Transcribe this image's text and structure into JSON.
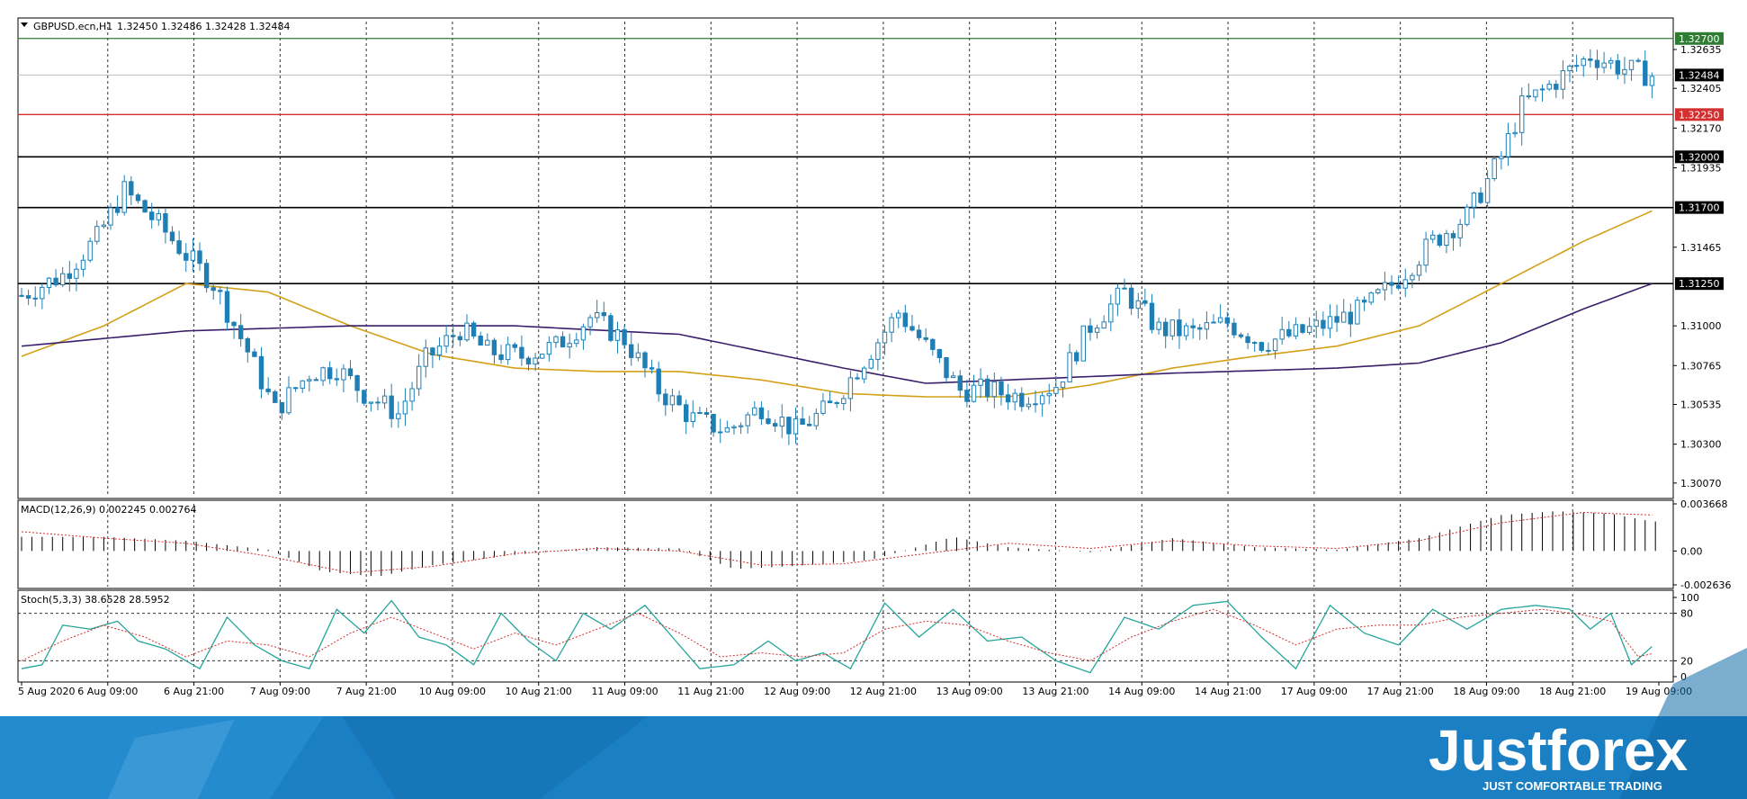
{
  "header": {
    "symbol": "GBPUSD.ecn,H1",
    "ohlc": "1.32450 1.32486 1.32428 1.32484"
  },
  "indicators": {
    "macd_label": "MACD(12,26,9) 0.002245 0.002764",
    "stoch_label": "Stoch(5,3,3) 38.6528 28.5952"
  },
  "brand": {
    "name": "Justforex",
    "tagline": "JUST COMFORTABLE TRADING"
  },
  "colors": {
    "candle_bull": "#1f7fb5",
    "candle_bear": "#1f7fb5",
    "ma_fast": "#d4a017",
    "ma_slow": "#3a1f6b",
    "level_green": "#2e7d32",
    "level_red": "#d32f2f",
    "level_black": "#000000",
    "macd_signal": "#d32f2f",
    "stoch_main": "#26a69a",
    "stoch_signal": "#d32f2f",
    "brand_bg": "#1b7fc4"
  },
  "chart_data": [
    {
      "type": "candlestick",
      "title": "GBPUSD.ecn,H1",
      "ylim": [
        1.3,
        1.328
      ],
      "y_ticks": [
        "1.32635",
        "1.32405",
        "1.32170",
        "1.31935",
        "1.31465",
        "1.31000",
        "1.30765",
        "1.30535",
        "1.30300",
        "1.30070"
      ],
      "x_ticks": [
        "5 Aug 2020",
        "6 Aug 09:00",
        "6 Aug 21:00",
        "7 Aug 09:00",
        "7 Aug 21:00",
        "10 Aug 09:00",
        "10 Aug 21:00",
        "11 Aug 09:00",
        "11 Aug 21:00",
        "12 Aug 09:00",
        "12 Aug 21:00",
        "13 Aug 09:00",
        "13 Aug 21:00",
        "14 Aug 09:00",
        "14 Aug 21:00",
        "17 Aug 09:00",
        "17 Aug 21:00",
        "18 Aug 09:00",
        "18 Aug 21:00",
        "19 Aug 09:00"
      ],
      "levels": [
        {
          "value": 1.327,
          "label": "1.32700",
          "color": "green"
        },
        {
          "value": 1.32484,
          "label": "1.32484",
          "color": "current"
        },
        {
          "value": 1.3225,
          "label": "1.32250",
          "color": "red"
        },
        {
          "value": 1.32,
          "label": "1.32000",
          "color": "black"
        },
        {
          "value": 1.317,
          "label": "1.31700",
          "color": "black"
        },
        {
          "value": 1.3125,
          "label": "1.31250",
          "color": "black"
        }
      ],
      "close_path": [
        [
          0,
          1.3118
        ],
        [
          6,
          1.313
        ],
        [
          11,
          1.3152
        ],
        [
          15,
          1.318
        ],
        [
          20,
          1.316
        ],
        [
          24,
          1.3142
        ],
        [
          28,
          1.3125
        ],
        [
          33,
          1.3085
        ],
        [
          37,
          1.305
        ],
        [
          42,
          1.3072
        ],
        [
          46,
          1.3075
        ],
        [
          50,
          1.306
        ],
        [
          55,
          1.3048
        ],
        [
          59,
          1.308
        ],
        [
          64,
          1.3098
        ],
        [
          68,
          1.3085
        ],
        [
          73,
          1.3082
        ],
        [
          78,
          1.3088
        ],
        [
          83,
          1.3105
        ],
        [
          88,
          1.3092
        ],
        [
          93,
          1.3062
        ],
        [
          98,
          1.3045
        ],
        [
          103,
          1.3038
        ],
        [
          108,
          1.3052
        ],
        [
          113,
          1.3038
        ],
        [
          118,
          1.3052
        ],
        [
          123,
          1.308
        ],
        [
          128,
          1.3108
        ],
        [
          132,
          1.3088
        ],
        [
          137,
          1.3062
        ],
        [
          141,
          1.3062
        ],
        [
          146,
          1.3058
        ],
        [
          151,
          1.3065
        ],
        [
          156,
          1.31
        ],
        [
          161,
          1.312
        ],
        [
          166,
          1.3098
        ],
        [
          171,
          1.3096
        ],
        [
          176,
          1.3102
        ],
        [
          181,
          1.309
        ],
        [
          186,
          1.3095
        ],
        [
          191,
          1.3102
        ],
        [
          196,
          1.311
        ],
        [
          201,
          1.3128
        ],
        [
          206,
          1.315
        ],
        [
          211,
          1.3165
        ],
        [
          216,
          1.32
        ],
        [
          219,
          1.323
        ],
        [
          224,
          1.3245
        ],
        [
          229,
          1.326
        ],
        [
          234,
          1.3252
        ],
        [
          238,
          1.3248
        ]
      ],
      "ma_fast": [
        [
          0,
          1.3082
        ],
        [
          12,
          1.31
        ],
        [
          24,
          1.3125
        ],
        [
          36,
          1.312
        ],
        [
          48,
          1.31
        ],
        [
          60,
          1.3083
        ],
        [
          72,
          1.3075
        ],
        [
          84,
          1.3073
        ],
        [
          96,
          1.3073
        ],
        [
          108,
          1.3068
        ],
        [
          120,
          1.306
        ],
        [
          132,
          1.3058
        ],
        [
          144,
          1.3058
        ],
        [
          156,
          1.3065
        ],
        [
          168,
          1.3075
        ],
        [
          180,
          1.3082
        ],
        [
          192,
          1.3088
        ],
        [
          204,
          1.31
        ],
        [
          216,
          1.3125
        ],
        [
          228,
          1.315
        ],
        [
          238,
          1.3168
        ]
      ],
      "ma_slow": [
        [
          0,
          1.3088
        ],
        [
          24,
          1.3097
        ],
        [
          48,
          1.31
        ],
        [
          72,
          1.31
        ],
        [
          96,
          1.3095
        ],
        [
          120,
          1.3075
        ],
        [
          132,
          1.3066
        ],
        [
          144,
          1.3068
        ],
        [
          168,
          1.3072
        ],
        [
          192,
          1.3075
        ],
        [
          204,
          1.3078
        ],
        [
          216,
          1.309
        ],
        [
          228,
          1.311
        ],
        [
          238,
          1.3125
        ]
      ]
    },
    {
      "type": "bar",
      "title": "MACD(12,26,9) 0.002245 0.002764",
      "ylim": [
        -0.002636,
        0.003668
      ],
      "y_ticks": [
        "0.003668",
        "0.00",
        "-0.002636"
      ],
      "histogram": [
        [
          0,
          0.0011
        ],
        [
          12,
          0.0011
        ],
        [
          24,
          0.0008
        ],
        [
          36,
          0.0001
        ],
        [
          44,
          -0.0016
        ],
        [
          52,
          -0.002
        ],
        [
          60,
          -0.0011
        ],
        [
          72,
          -0.0003
        ],
        [
          84,
          0.0003
        ],
        [
          96,
          0.0002
        ],
        [
          104,
          -0.0014
        ],
        [
          112,
          -0.0012
        ],
        [
          124,
          -0.0007
        ],
        [
          136,
          0.0011
        ],
        [
          144,
          0.0003
        ],
        [
          156,
          -0.0001
        ],
        [
          168,
          0.001
        ],
        [
          180,
          0.0003
        ],
        [
          192,
          0.0001
        ],
        [
          204,
          0.001
        ],
        [
          216,
          0.0028
        ],
        [
          224,
          0.0031
        ],
        [
          232,
          0.0029
        ],
        [
          238,
          0.0023
        ]
      ],
      "signal": [
        [
          0,
          0.0015
        ],
        [
          12,
          0.001
        ],
        [
          24,
          0.0006
        ],
        [
          36,
          -0.0004
        ],
        [
          48,
          -0.0017
        ],
        [
          60,
          -0.0012
        ],
        [
          72,
          -0.0002
        ],
        [
          84,
          0.0002
        ],
        [
          96,
          0.0
        ],
        [
          108,
          -0.0011
        ],
        [
          120,
          -0.001
        ],
        [
          132,
          -0.0002
        ],
        [
          144,
          0.0006
        ],
        [
          156,
          0.0002
        ],
        [
          168,
          0.0008
        ],
        [
          180,
          0.0004
        ],
        [
          192,
          0.0002
        ],
        [
          204,
          0.0008
        ],
        [
          216,
          0.0022
        ],
        [
          228,
          0.003
        ],
        [
          238,
          0.0028
        ]
      ]
    },
    {
      "type": "line",
      "title": "Stoch(5,3,3) 38.6528 28.5952",
      "ylim": [
        0,
        100
      ],
      "y_ticks": [
        "100",
        "80",
        "20",
        "0"
      ],
      "levels": [
        80,
        20
      ],
      "main": [
        [
          0,
          10
        ],
        [
          3,
          15
        ],
        [
          6,
          65
        ],
        [
          10,
          60
        ],
        [
          14,
          70
        ],
        [
          17,
          45
        ],
        [
          21,
          35
        ],
        [
          26,
          10
        ],
        [
          30,
          75
        ],
        [
          34,
          40
        ],
        [
          38,
          20
        ],
        [
          42,
          10
        ],
        [
          46,
          85
        ],
        [
          50,
          55
        ],
        [
          54,
          96
        ],
        [
          58,
          50
        ],
        [
          62,
          40
        ],
        [
          66,
          15
        ],
        [
          70,
          80
        ],
        [
          74,
          45
        ],
        [
          78,
          20
        ],
        [
          82,
          80
        ],
        [
          86,
          60
        ],
        [
          91,
          90
        ],
        [
          95,
          50
        ],
        [
          99,
          10
        ],
        [
          104,
          15
        ],
        [
          109,
          45
        ],
        [
          113,
          20
        ],
        [
          117,
          30
        ],
        [
          121,
          10
        ],
        [
          126,
          93
        ],
        [
          131,
          50
        ],
        [
          136,
          85
        ],
        [
          141,
          45
        ],
        [
          146,
          50
        ],
        [
          151,
          20
        ],
        [
          156,
          5
        ],
        [
          161,
          75
        ],
        [
          166,
          60
        ],
        [
          171,
          90
        ],
        [
          176,
          95
        ],
        [
          181,
          50
        ],
        [
          186,
          10
        ],
        [
          191,
          90
        ],
        [
          196,
          55
        ],
        [
          201,
          40
        ],
        [
          206,
          85
        ],
        [
          211,
          60
        ],
        [
          216,
          85
        ],
        [
          221,
          90
        ],
        [
          226,
          85
        ],
        [
          229,
          60
        ],
        [
          232,
          80
        ],
        [
          235,
          15
        ],
        [
          238,
          38
        ]
      ],
      "signal": [
        [
          0,
          20
        ],
        [
          6,
          45
        ],
        [
          12,
          65
        ],
        [
          18,
          50
        ],
        [
          24,
          25
        ],
        [
          30,
          45
        ],
        [
          36,
          40
        ],
        [
          42,
          25
        ],
        [
          48,
          55
        ],
        [
          54,
          75
        ],
        [
          60,
          55
        ],
        [
          66,
          35
        ],
        [
          72,
          55
        ],
        [
          78,
          40
        ],
        [
          84,
          60
        ],
        [
          90,
          80
        ],
        [
          96,
          55
        ],
        [
          102,
          25
        ],
        [
          108,
          30
        ],
        [
          114,
          25
        ],
        [
          120,
          30
        ],
        [
          126,
          60
        ],
        [
          132,
          70
        ],
        [
          138,
          65
        ],
        [
          144,
          45
        ],
        [
          150,
          30
        ],
        [
          156,
          20
        ],
        [
          162,
          50
        ],
        [
          168,
          70
        ],
        [
          174,
          85
        ],
        [
          180,
          65
        ],
        [
          186,
          40
        ],
        [
          192,
          60
        ],
        [
          198,
          65
        ],
        [
          204,
          65
        ],
        [
          210,
          75
        ],
        [
          216,
          80
        ],
        [
          222,
          85
        ],
        [
          228,
          78
        ],
        [
          232,
          70
        ],
        [
          236,
          25
        ],
        [
          238,
          29
        ]
      ]
    }
  ]
}
